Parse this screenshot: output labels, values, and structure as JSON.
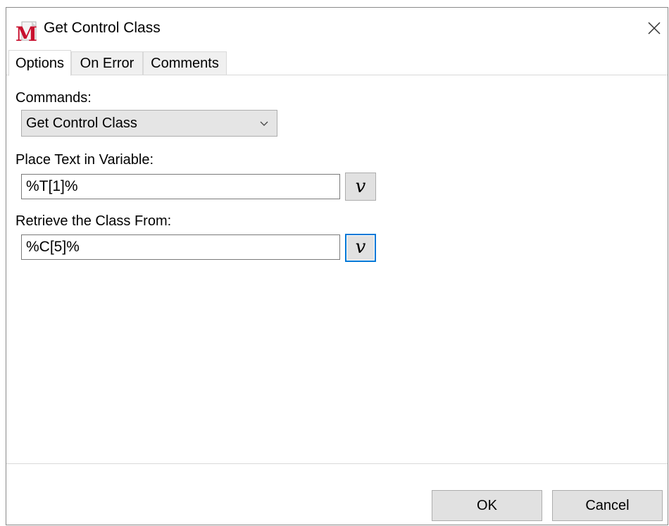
{
  "window": {
    "title": "Get Control Class",
    "app_icon": "macro-m-icon",
    "close_icon": "close-icon"
  },
  "tabs": [
    {
      "label": "Options",
      "active": true
    },
    {
      "label": "On Error",
      "active": false
    },
    {
      "label": "Comments",
      "active": false
    }
  ],
  "options": {
    "commands_label": "Commands:",
    "commands_value": "Get Control Class",
    "place_text_label": "Place Text in Variable:",
    "place_text_value": "%T[1]%",
    "retrieve_label": "Retrieve the Class From:",
    "retrieve_value": "%C[5]%",
    "variable_button_label": "v"
  },
  "footer": {
    "ok_label": "OK",
    "cancel_label": "Cancel"
  },
  "colors": {
    "focus_border": "#0078d7",
    "icon_red": "#c8102e"
  }
}
